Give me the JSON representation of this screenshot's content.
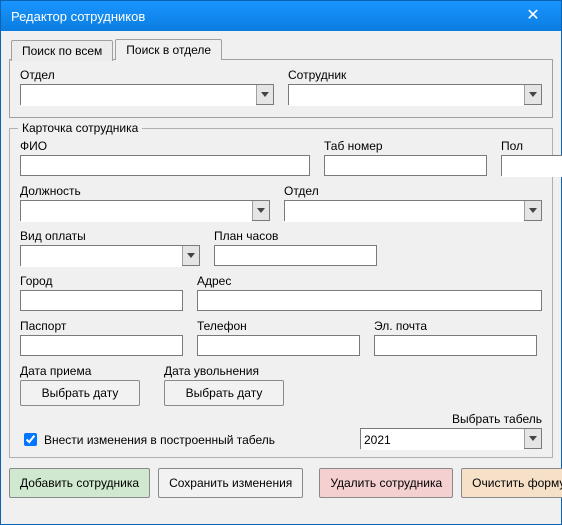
{
  "window": {
    "title": "Редактор сотрудников"
  },
  "tabs": {
    "search_all": "Поиск по всем",
    "search_dept": "Поиск в отделе"
  },
  "search": {
    "department_label": "Отдел",
    "employee_label": "Сотрудник",
    "department_value": "",
    "employee_value": ""
  },
  "card": {
    "legend": "Карточка сотрудника",
    "fio_label": "ФИО",
    "fio_value": "",
    "tab_number_label": "Таб номер",
    "tab_number_value": "",
    "gender_label": "Пол",
    "gender_value": "",
    "position_label": "Должность",
    "position_value": "",
    "department_label": "Отдел",
    "department_value": "",
    "pay_type_label": "Вид оплаты",
    "pay_type_value": "",
    "plan_hours_label": "План часов",
    "plan_hours_value": "",
    "city_label": "Город",
    "city_value": "",
    "address_label": "Адрес",
    "address_value": "",
    "passport_label": "Паспорт",
    "passport_value": "",
    "phone_label": "Телефон",
    "phone_value": "",
    "email_label": "Эл. почта",
    "email_value": "",
    "hire_date_label": "Дата приема",
    "fire_date_label": "Дата увольнения",
    "pick_date": "Выбрать дату",
    "apply_to_timesheet_label": "Внести изменения в построенный табель",
    "apply_to_timesheet_checked": true,
    "select_timesheet_label": "Выбрать табель",
    "timesheet_value": "2021"
  },
  "actions": {
    "add": "Добавить сотрудника",
    "save": "Сохранить изменения",
    "delete": "Удалить сотрудника",
    "clear": "Очистить форму"
  }
}
